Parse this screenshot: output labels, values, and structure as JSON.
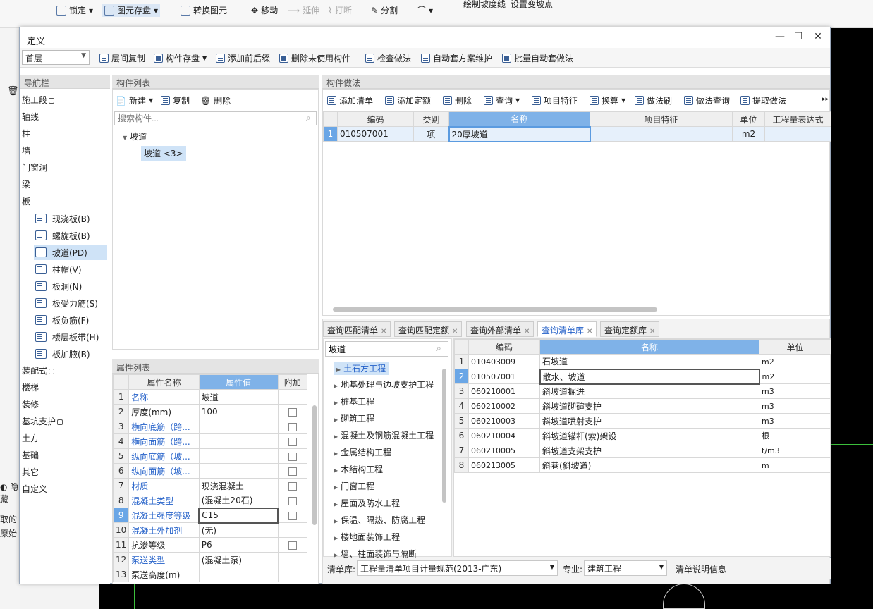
{
  "ribbon": {
    "lock": "锁定",
    "save_elem": "图元存盘",
    "convert": "转换图元",
    "move": "移动",
    "extend": "延伸",
    "break": "打断",
    "split": "分割",
    "draw_slope_line": "绘制坡度线",
    "set_slope_point": "设置变坡点"
  },
  "left_strip": {
    "hide": "隐藏",
    "take": "取的",
    "origin": "原始"
  },
  "dialog": {
    "title": "定义",
    "toolbar": {
      "floor": "首层",
      "copy_between_floors": "层间复制",
      "component_save": "构件存盘",
      "add_prefix_suffix": "添加前后缀",
      "delete_unused": "删除未使用构件",
      "check_method": "检查做法",
      "auto_maintain": "自动套方案维护",
      "batch_auto": "批量自动套做法"
    },
    "nav": {
      "header": "导航栏",
      "items": [
        "施工段",
        "轴线",
        "柱",
        "墙",
        "门窗洞",
        "梁",
        "板"
      ],
      "sub_items": [
        "现浇板(B)",
        "螺旋板(B)",
        "坡道(PD)",
        "柱帽(V)",
        "板洞(N)",
        "板受力筋(S)",
        "板负筋(F)",
        "楼层板带(H)",
        "板加腋(B)"
      ],
      "items2": [
        "装配式",
        "楼梯",
        "装修",
        "基坑支护",
        "土方",
        "基础",
        "其它",
        "自定义"
      ]
    },
    "component_list": {
      "header": "构件列表",
      "new": "新建",
      "copy": "复制",
      "delete": "删除",
      "search_placeholder": "搜索构件...",
      "tree_root": "坡道",
      "tree_child": "坡道 <3>"
    },
    "property_list": {
      "header": "属性列表",
      "columns": [
        "属性名称",
        "属性值",
        "附加"
      ],
      "rows": [
        {
          "n": "1",
          "name": "名称",
          "value": "坡道"
        },
        {
          "n": "2",
          "name": "厚度(mm)",
          "value": "100"
        },
        {
          "n": "3",
          "name": "横向底筋（跨...",
          "value": ""
        },
        {
          "n": "4",
          "name": "横向面筋（跨...",
          "value": ""
        },
        {
          "n": "5",
          "name": "纵向底筋（坡...",
          "value": ""
        },
        {
          "n": "6",
          "name": "纵向面筋（坡...",
          "value": ""
        },
        {
          "n": "7",
          "name": "材质",
          "value": "现浇混凝土"
        },
        {
          "n": "8",
          "name": "混凝土类型",
          "value": "(混凝土20石)"
        },
        {
          "n": "9",
          "name": "混凝土强度等级",
          "value": "C15"
        },
        {
          "n": "10",
          "name": "混凝土外加剂",
          "value": "(无)"
        },
        {
          "n": "11",
          "name": "抗渗等级",
          "value": "P6"
        },
        {
          "n": "12",
          "name": "泵送类型",
          "value": "(混凝土泵)"
        },
        {
          "n": "13",
          "name": "泵送高度(m)",
          "value": ""
        }
      ]
    },
    "method": {
      "header": "构件做法",
      "toolbar": [
        "添加清单",
        "添加定额",
        "删除",
        "查询",
        "项目特征",
        "换算",
        "做法刷",
        "做法查询",
        "提取做法"
      ],
      "columns": [
        "编码",
        "类别",
        "名称",
        "项目特征",
        "单位",
        "工程量表达式"
      ],
      "rows": [
        {
          "n": "1",
          "code": "010507001",
          "type": "项",
          "name": "20厚坡道",
          "feature": "",
          "unit": "m2",
          "expr": ""
        }
      ]
    },
    "query": {
      "tabs": [
        "查询匹配清单",
        "查询匹配定额",
        "查询外部清单",
        "查询清单库",
        "查询定额库"
      ],
      "search_value": "坡道",
      "tree": [
        "土石方工程",
        "地基处理与边坡支护工程",
        "桩基工程",
        "砌筑工程",
        "混凝土及钢筋混凝土工程",
        "金属结构工程",
        "木结构工程",
        "门窗工程",
        "屋面及防水工程",
        "保温、隔热、防腐工程",
        "楼地面装饰工程",
        "墙、柱面装饰与隔断"
      ],
      "columns": [
        "编码",
        "名称",
        "单位"
      ],
      "rows": [
        {
          "n": "1",
          "code": "010403009",
          "name": "石坡道",
          "unit": "m2"
        },
        {
          "n": "2",
          "code": "010507001",
          "name": "散水、坡道",
          "unit": "m2"
        },
        {
          "n": "3",
          "code": "060210001",
          "name": "斜坡道掘进",
          "unit": "m3"
        },
        {
          "n": "4",
          "code": "060210002",
          "name": "斜坡道砌碹支护",
          "unit": "m3"
        },
        {
          "n": "5",
          "code": "060210003",
          "name": "斜坡道喷射支护",
          "unit": "m3"
        },
        {
          "n": "6",
          "code": "060210004",
          "name": "斜坡道锚杆(索)架设",
          "unit": "根"
        },
        {
          "n": "7",
          "code": "060210005",
          "name": "斜坡道支架支护",
          "unit": "t/m3"
        },
        {
          "n": "8",
          "code": "060213005",
          "name": "斜巷(斜坡道)",
          "unit": "m"
        }
      ],
      "footer": {
        "lib_label": "清单库:",
        "lib_value": "工程量清单项目计量规范(2013-广东)",
        "major_label": "专业:",
        "major_value": "建筑工程",
        "info": "清单说明信息"
      }
    }
  }
}
